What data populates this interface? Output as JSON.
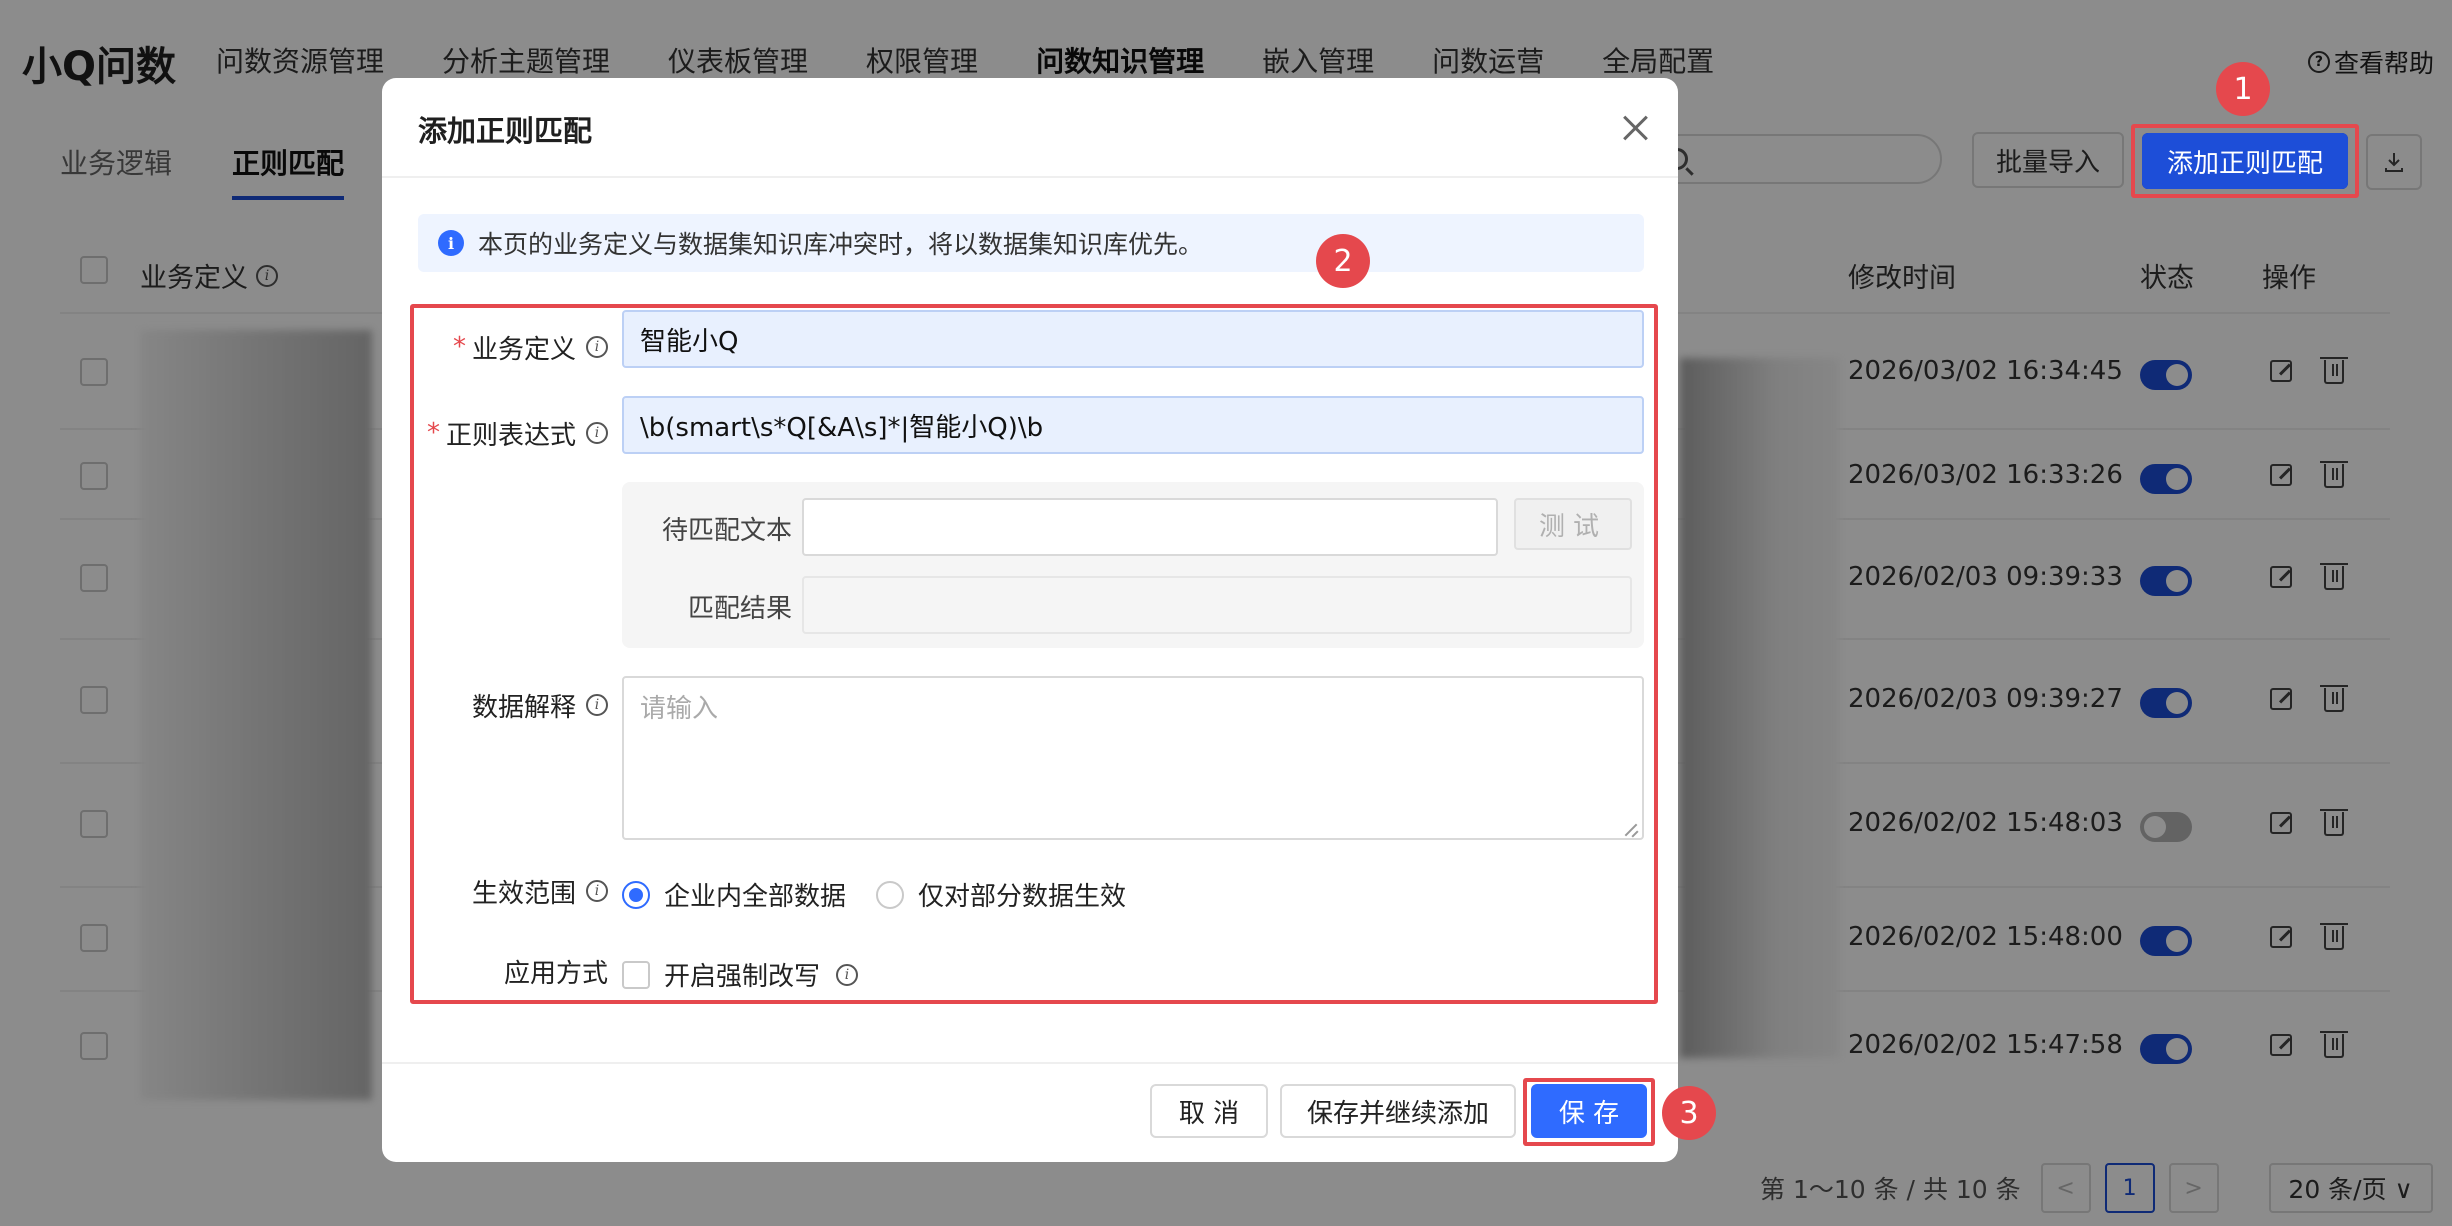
{
  "app": {
    "brand": "小Q问数",
    "nav": [
      "问数资源管理",
      "分析主题管理",
      "仪表板管理",
      "权限管理",
      "问数知识管理",
      "嵌入管理",
      "问数运营",
      "全局配置"
    ],
    "help": "查看帮助",
    "help_icon": "question-circle-icon"
  },
  "subtabs": [
    "业务逻辑",
    "正则匹配"
  ],
  "toolbar": {
    "batch_import": "批量导入",
    "add_regex": "添加正则匹配"
  },
  "table": {
    "headers": {
      "business_definition": "业务定义",
      "modified_time": "修改时间",
      "status": "状态",
      "actions": "操作"
    },
    "rows": [
      {
        "modified": "2026/03/02 16:34:45",
        "enabled": true
      },
      {
        "modified": "2026/03/02 16:33:26",
        "enabled": true
      },
      {
        "modified": "2026/02/03 09:39:33",
        "enabled": true
      },
      {
        "modified": "2026/02/03 09:39:27",
        "enabled": true
      },
      {
        "modified": "2026/02/02 15:48:03",
        "enabled": false
      },
      {
        "modified": "2026/02/02 15:48:00",
        "enabled": true
      },
      {
        "modified": "2026/02/02 15:47:58",
        "enabled": true
      }
    ]
  },
  "pager": {
    "summary": "第 1～10 条 / 共 10 条",
    "prev": "<",
    "current": "1",
    "next": ">",
    "page_size": "20 条/页 ∨"
  },
  "modal": {
    "title": "添加正则匹配",
    "notice": "本页的业务定义与数据集知识库冲突时，将以数据集知识库优先。",
    "fields": {
      "business_definition": {
        "label": "业务定义",
        "value": "智能小Q"
      },
      "regex": {
        "label": "正则表达式",
        "value": "\\b(smart\\s*Q[&A\\s]*|智能小Q)\\b"
      },
      "match_text": {
        "label": "待匹配文本",
        "value": ""
      },
      "test_button": "测试",
      "match_result": {
        "label": "匹配结果",
        "value": ""
      },
      "data_explanation": {
        "label": "数据解释",
        "placeholder": "请输入"
      },
      "scope": {
        "label": "生效范围",
        "options": [
          "企业内全部数据",
          "仅对部分数据生效"
        ],
        "selected": "企业内全部数据"
      },
      "apply_mode": {
        "label": "应用方式",
        "checkbox": "开启强制改写",
        "checked": false
      }
    },
    "buttons": {
      "cancel": "取 消",
      "save_continue": "保存并继续添加",
      "save": "保 存"
    }
  },
  "annotations": [
    "1",
    "2",
    "3"
  ],
  "colors": {
    "primary": "#1d4ed8",
    "accent_blue": "#2f6bff",
    "highlight_red": "#e5484d"
  }
}
